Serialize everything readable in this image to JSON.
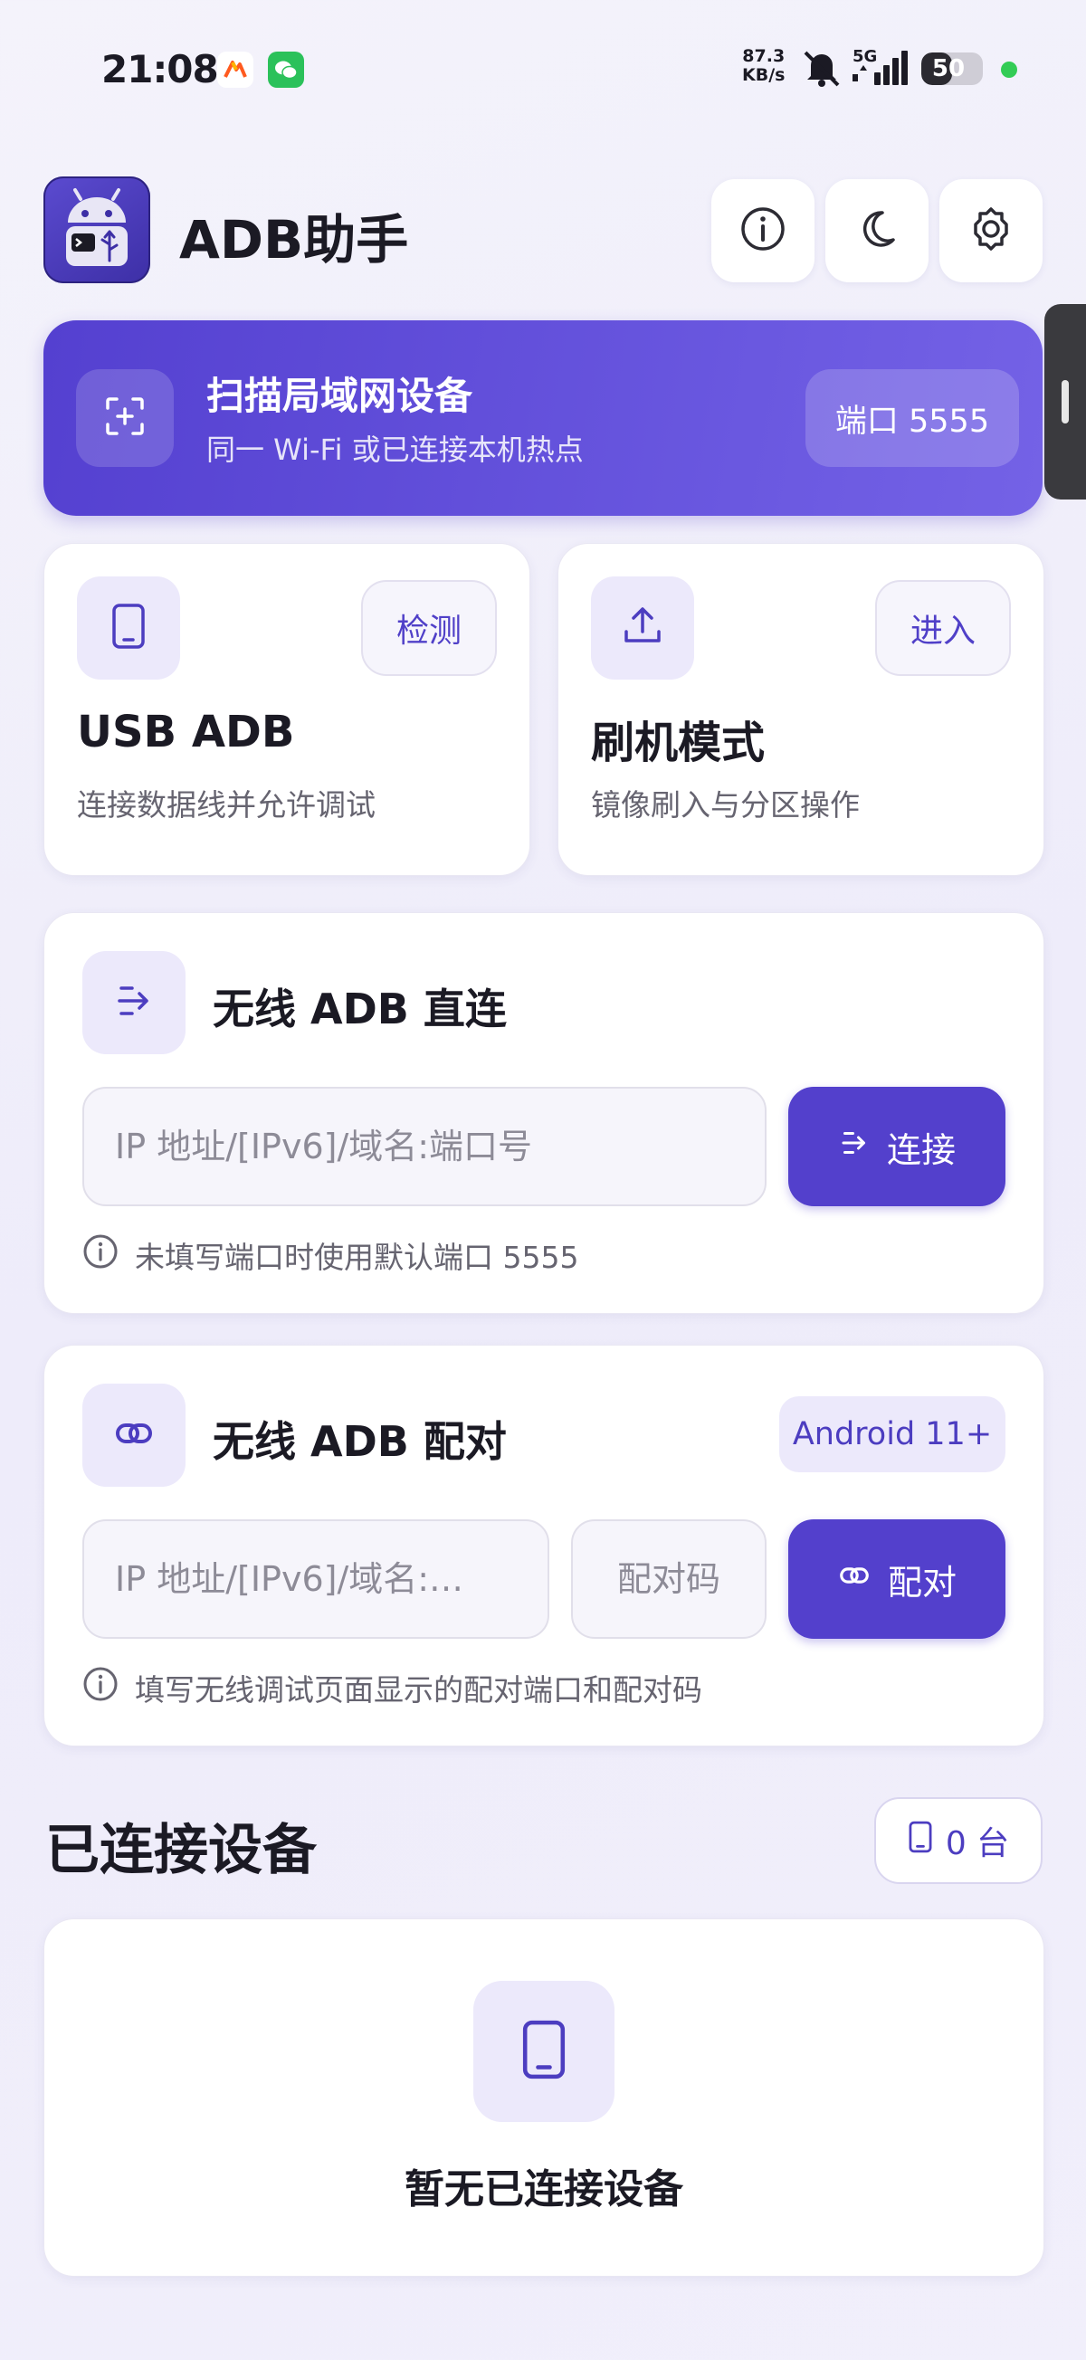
{
  "status_bar": {
    "time": "21:08",
    "net_speed_value": "87.3",
    "net_speed_unit": "KB/s",
    "network": "5G",
    "battery": "50",
    "battery_level": 0.5
  },
  "header": {
    "title": "ADB助手"
  },
  "scan": {
    "title": "扫描局域网设备",
    "subtitle": "同一 Wi-Fi 或已连接本机热点",
    "port_label": "端口 5555"
  },
  "usb_card": {
    "action": "检测",
    "title": "USB ADB",
    "subtitle": "连接数据线并允许调试"
  },
  "flash_card": {
    "action": "进入",
    "title": "刷机模式",
    "subtitle": "镜像刷入与分区操作"
  },
  "wireless_connect": {
    "title": "无线 ADB 直连",
    "input_placeholder": "IP 地址/[IPv6]/域名:端口号",
    "button": "连接",
    "hint": "未填写端口时使用默认端口 5555"
  },
  "wireless_pair": {
    "title": "无线 ADB 配对",
    "badge": "Android 11+",
    "address_placeholder": "IP 地址/[IPv6]/域名:…",
    "code_placeholder": "配对码",
    "button": "配对",
    "hint": "填写无线调试页面显示的配对端口和配对码"
  },
  "devices": {
    "title": "已连接设备",
    "count": "0 台",
    "empty_text": "暂无已连接设备"
  },
  "colors": {
    "accent": "#5340cc",
    "accent_light": "#ece9fb",
    "charge_indicator": "#33cc55"
  }
}
